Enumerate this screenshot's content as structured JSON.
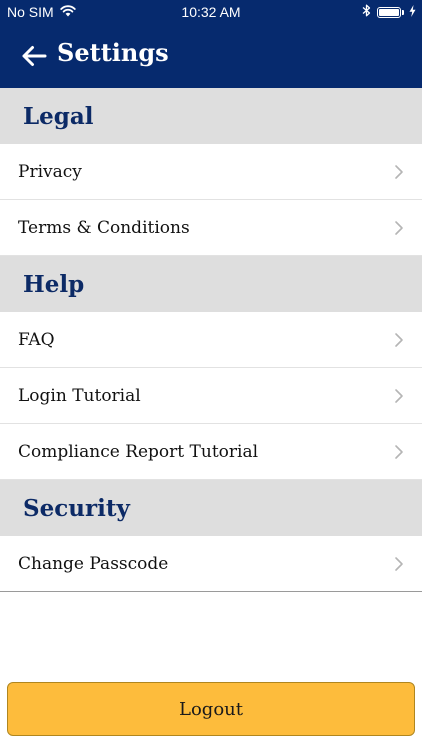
{
  "status_bar": {
    "carrier": "No SIM",
    "time": "10:32 AM",
    "wifi_icon": "wifi-icon",
    "bluetooth_icon": "bluetooth-icon",
    "battery_icon": "battery-icon",
    "charging_icon": "charging-bolt-icon",
    "battery_level": 1.0
  },
  "nav": {
    "title": "Settings",
    "back_icon": "back-arrow-icon"
  },
  "sections": [
    {
      "header": "Legal",
      "items": [
        {
          "label": "Privacy"
        },
        {
          "label": "Terms & Conditions"
        }
      ]
    },
    {
      "header": "Help",
      "items": [
        {
          "label": "FAQ"
        },
        {
          "label": "Login Tutorial"
        },
        {
          "label": "Compliance Report Tutorial"
        }
      ]
    },
    {
      "header": "Security",
      "items": [
        {
          "label": "Change Passcode"
        }
      ]
    }
  ],
  "logout_label": "Logout",
  "colors": {
    "nav_background": "#062A6E",
    "section_header_background": "#DEDEDE",
    "section_header_text": "#0C2A66",
    "logout_background": "#FDBC3C",
    "chevron": "#B5B5B5"
  }
}
